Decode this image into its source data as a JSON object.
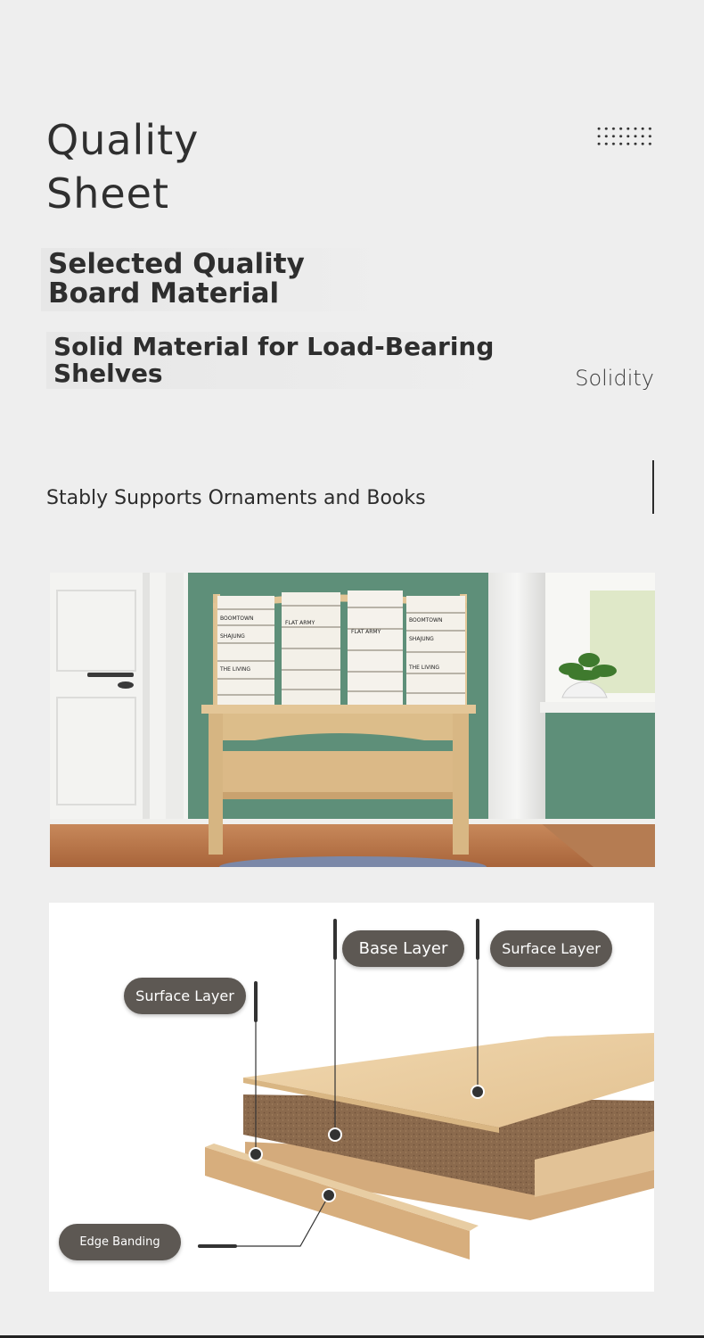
{
  "header": {
    "title_line1": "Quality",
    "title_line2": "Sheet",
    "feature_1": "Selected Quality Board Material",
    "feature_2": "Solid Material for Load-Bearing Shelves",
    "tag": "Solidity",
    "subtitle": "Stably Supports Ornaments and Books"
  },
  "photo": {
    "book_spines": [
      "BOOMTOWN",
      "SHAJUNG",
      "THE LIVING",
      "FLAT ARMY"
    ]
  },
  "diagram": {
    "labels": {
      "base_layer": "Base Layer",
      "surface_layer_right": "Surface Layer",
      "surface_layer_left": "Surface Layer",
      "edge_banding": "Edge Banding"
    }
  },
  "colors": {
    "background": "#eeeeee",
    "wall_green": "#5e8f79",
    "wood": "#d9b886",
    "label_pill": "#5d5853"
  }
}
